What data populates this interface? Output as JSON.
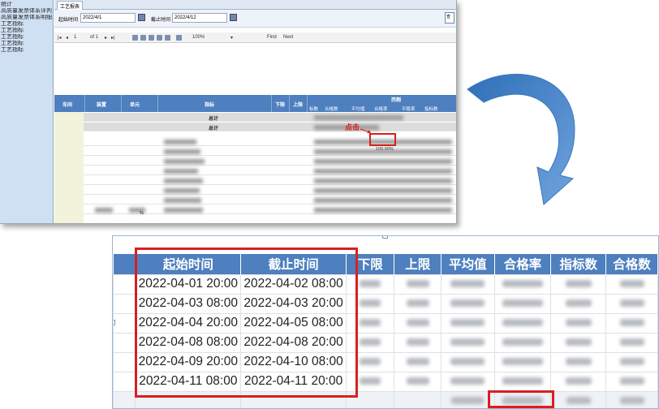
{
  "top": {
    "sidebar": {
      "items": [
        "统计",
        "高质量发票体系评判",
        "高质量发票体系明细",
        "工艺指标",
        "工艺指标",
        "工艺指标",
        "工艺指标",
        "工艺指标"
      ]
    },
    "tab_label": "工艺报表",
    "filter": {
      "start_label": "起始时间",
      "start_value": "2022/4/1",
      "end_label": "截止时间",
      "end_value": "2022/4/12",
      "query_btn": "查"
    },
    "toolbar": {
      "page": "1",
      "of_total": "of 1",
      "zoom": "100%",
      "find": "Find",
      "next": "Next"
    },
    "table": {
      "headers": [
        "车间",
        "装置",
        "单元",
        "指标",
        "下限",
        "上限"
      ],
      "group_header": "西侧",
      "sub_headers": [
        "标数",
        "合格数",
        "平均值",
        "合格率",
        "平稳率",
        "指标数"
      ],
      "total_label": "总计",
      "click_note": "点击",
      "percent": "100.00%",
      "small_pct": "%"
    }
  },
  "bottom": {
    "headers": [
      "起始时间",
      "截止时间",
      "下限",
      "上限",
      "平均值",
      "合格率",
      "指标数",
      "合格数"
    ],
    "rows": [
      [
        "2022-04-01 20:00",
        "2022-04-02 08:00"
      ],
      [
        "2022-04-03 08:00",
        "2022-04-03 20:00"
      ],
      [
        "2022-04-04 20:00",
        "2022-04-05 08:00"
      ],
      [
        "2022-04-08 08:00",
        "2022-04-08 20:00"
      ],
      [
        "2022-04-09 20:00",
        "2022-04-10 08:00"
      ],
      [
        "2022-04-11 08:00",
        "2022-04-11 20:00"
      ]
    ]
  },
  "colors": {
    "header_blue": "#4e7fbf",
    "highlight_red": "#d62020",
    "arrow_blue": "#4d8bd0"
  }
}
